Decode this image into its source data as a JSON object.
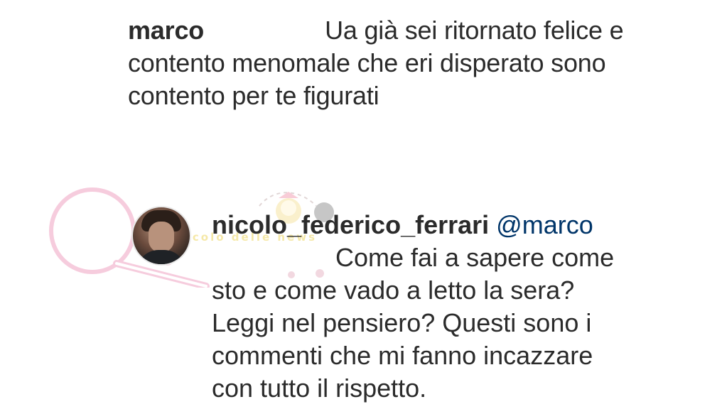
{
  "comments": [
    {
      "username": "marco",
      "text": "Ua già sei ritornato felice e contento menomale che eri disperato sono contento per te figurati"
    }
  ],
  "reply": {
    "username": "nicolo_federico_ferrari",
    "mention": "@marco",
    "text": "Come fai a sapere come sto e come vado a letto la sera? Leggi nel pensiero? Questi sono i commenti che mi fanno incazzare con tutto il rispetto."
  },
  "watermark": {
    "logo_text": "Vicolo delle News",
    "ribbon_text": "vicolo delle news"
  },
  "colors": {
    "text": "#2b2b2b",
    "mention": "#003569",
    "watermark_pink": "#f0a3c3",
    "watermark_yellow": "#f1dd7a"
  },
  "icons": {
    "avatar": "profile-photo"
  }
}
